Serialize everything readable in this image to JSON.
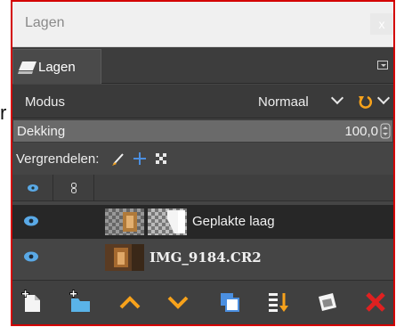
{
  "window": {
    "title": "Lagen",
    "close_glyph": "x"
  },
  "tab": {
    "label": "Lagen",
    "icon": "layers-icon"
  },
  "mode": {
    "label": "Modus",
    "value": "Normaal"
  },
  "opacity": {
    "label": "Dekking",
    "value": "100,0",
    "fraction": 1.0
  },
  "lock": {
    "label": "Vergrendelen:",
    "icons": [
      "lock-pixels-icon",
      "lock-position-icon",
      "lock-alpha-icon"
    ]
  },
  "layers": [
    {
      "name": "Geplakte laag",
      "visible": true,
      "selected": true,
      "has_mask": true
    },
    {
      "name": "IMG_9184.CR2",
      "visible": true,
      "selected": false,
      "has_mask": false
    }
  ],
  "toolbar": {
    "buttons": [
      "new-layer-icon",
      "new-layer-group-icon",
      "raise-layer-icon",
      "lower-layer-icon",
      "duplicate-layer-icon",
      "merge-down-icon",
      "add-mask-icon",
      "delete-layer-icon"
    ]
  },
  "background": {
    "fragment_a": "r"
  },
  "colors": {
    "accent_orange": "#f7a21b",
    "eye_blue": "#5aa9e6",
    "delete_red": "#e02020",
    "duplicate_blue": "#4b8fe0"
  }
}
